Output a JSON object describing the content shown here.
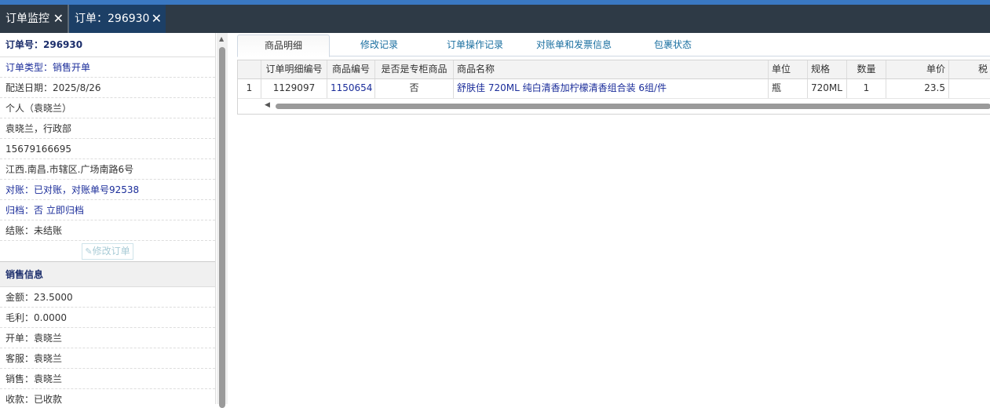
{
  "tabs": [
    {
      "label": "订单监控"
    },
    {
      "label": "订单：296930"
    }
  ],
  "order": {
    "number": "订单号：296930",
    "type": "订单类型：销售开单",
    "delivery_date": "配送日期：2025/8/26",
    "customer": "个人（袁晓兰）",
    "contact": "袁晓兰，行政部",
    "phone": "15679166695",
    "address": "江西.南昌.市辖区.广场南路6号",
    "reconcile": "对账：已对账，对账单号92538",
    "archive": "归档：否 立即归档",
    "settle": "结账：未结账",
    "edit_button": "修改订单"
  },
  "sales": {
    "title": "销售信息",
    "amount": "金额：23.5000",
    "profit": "毛利：0.0000",
    "creator": "开单：袁晓兰",
    "service": "客服：袁晓兰",
    "salesperson": "销售：袁晓兰",
    "payment": "收款：已收款"
  },
  "subtabs": [
    {
      "label": "商品明细"
    },
    {
      "label": "修改记录"
    },
    {
      "label": "订单操作记录"
    },
    {
      "label": "对账单和发票信息"
    },
    {
      "label": "包裹状态"
    }
  ],
  "table": {
    "headers": [
      "",
      "订单明细编号",
      "商品编号",
      "是否是专柜商品",
      "商品名称",
      "单位",
      "规格",
      "数量",
      "单价",
      "税"
    ],
    "rows": [
      [
        "1",
        "1129097",
        "1150654",
        "否",
        "舒肤佳 720ML 纯白清香加柠檬清香组合装 6组/件",
        "瓶",
        "720ML",
        "1",
        "23.5",
        ""
      ]
    ]
  },
  "colors": {
    "tabbar": "#2e3a46",
    "active_tab": "#1c3f66",
    "link": "#1b2d9a",
    "subtab_link": "#1a6fa0"
  },
  "icons": {
    "close": "close-icon",
    "edit": "edit-icon",
    "scroll_up": "scroll-up-arrow-icon",
    "scroll_left": "scroll-left-arrow-icon"
  }
}
